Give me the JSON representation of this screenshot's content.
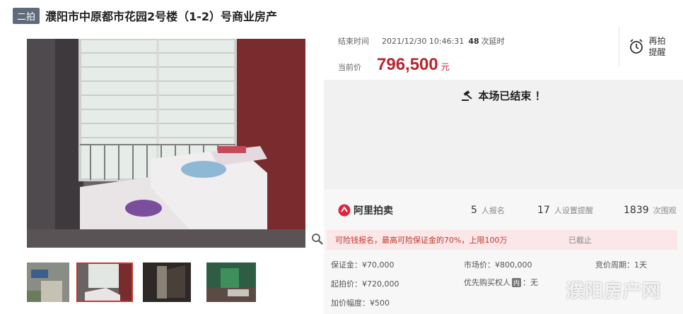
{
  "title": {
    "badge": "二拍",
    "text": "濮阳市中原都市花园2号楼（1-2）号商业房产"
  },
  "auction": {
    "end_label": "结束时间",
    "end_time": "2021/12/30 10:46:31",
    "delay_count": "48",
    "delay_label": "次延时",
    "price_label": "当前价",
    "price": "796,500",
    "price_unit": "元",
    "reminder_label": "再拍提醒",
    "ended_text": "本场已结束 ！"
  },
  "stats": {
    "logo": "阿里拍卖",
    "signups": "5",
    "signups_label": "人报名",
    "reminders": "17",
    "reminders_label": "人设置提醒",
    "views": "1839",
    "views_label": "次围观"
  },
  "notice": {
    "text": "可险钱报名，最高可险保证金的70%，上限100万",
    "status": "已截止"
  },
  "details": {
    "deposit": "保证金：¥70,000",
    "market_price": "市场价：¥800,000",
    "cycle": "竞价周期：1天",
    "start_price": "起拍价：¥720,000",
    "priority_prefix": "优先购买权人",
    "priority_tag": "内",
    "priority_value": "：无",
    "increment": "加价幅度：¥500"
  },
  "watermark": "濮阳房产网",
  "icons": [
    "gavel-icon",
    "alarm-clock-icon",
    "zoom-icon",
    "ali-logo-icon"
  ],
  "colors": {
    "accent": "#b8252f",
    "badge": "#5f6b7a"
  }
}
